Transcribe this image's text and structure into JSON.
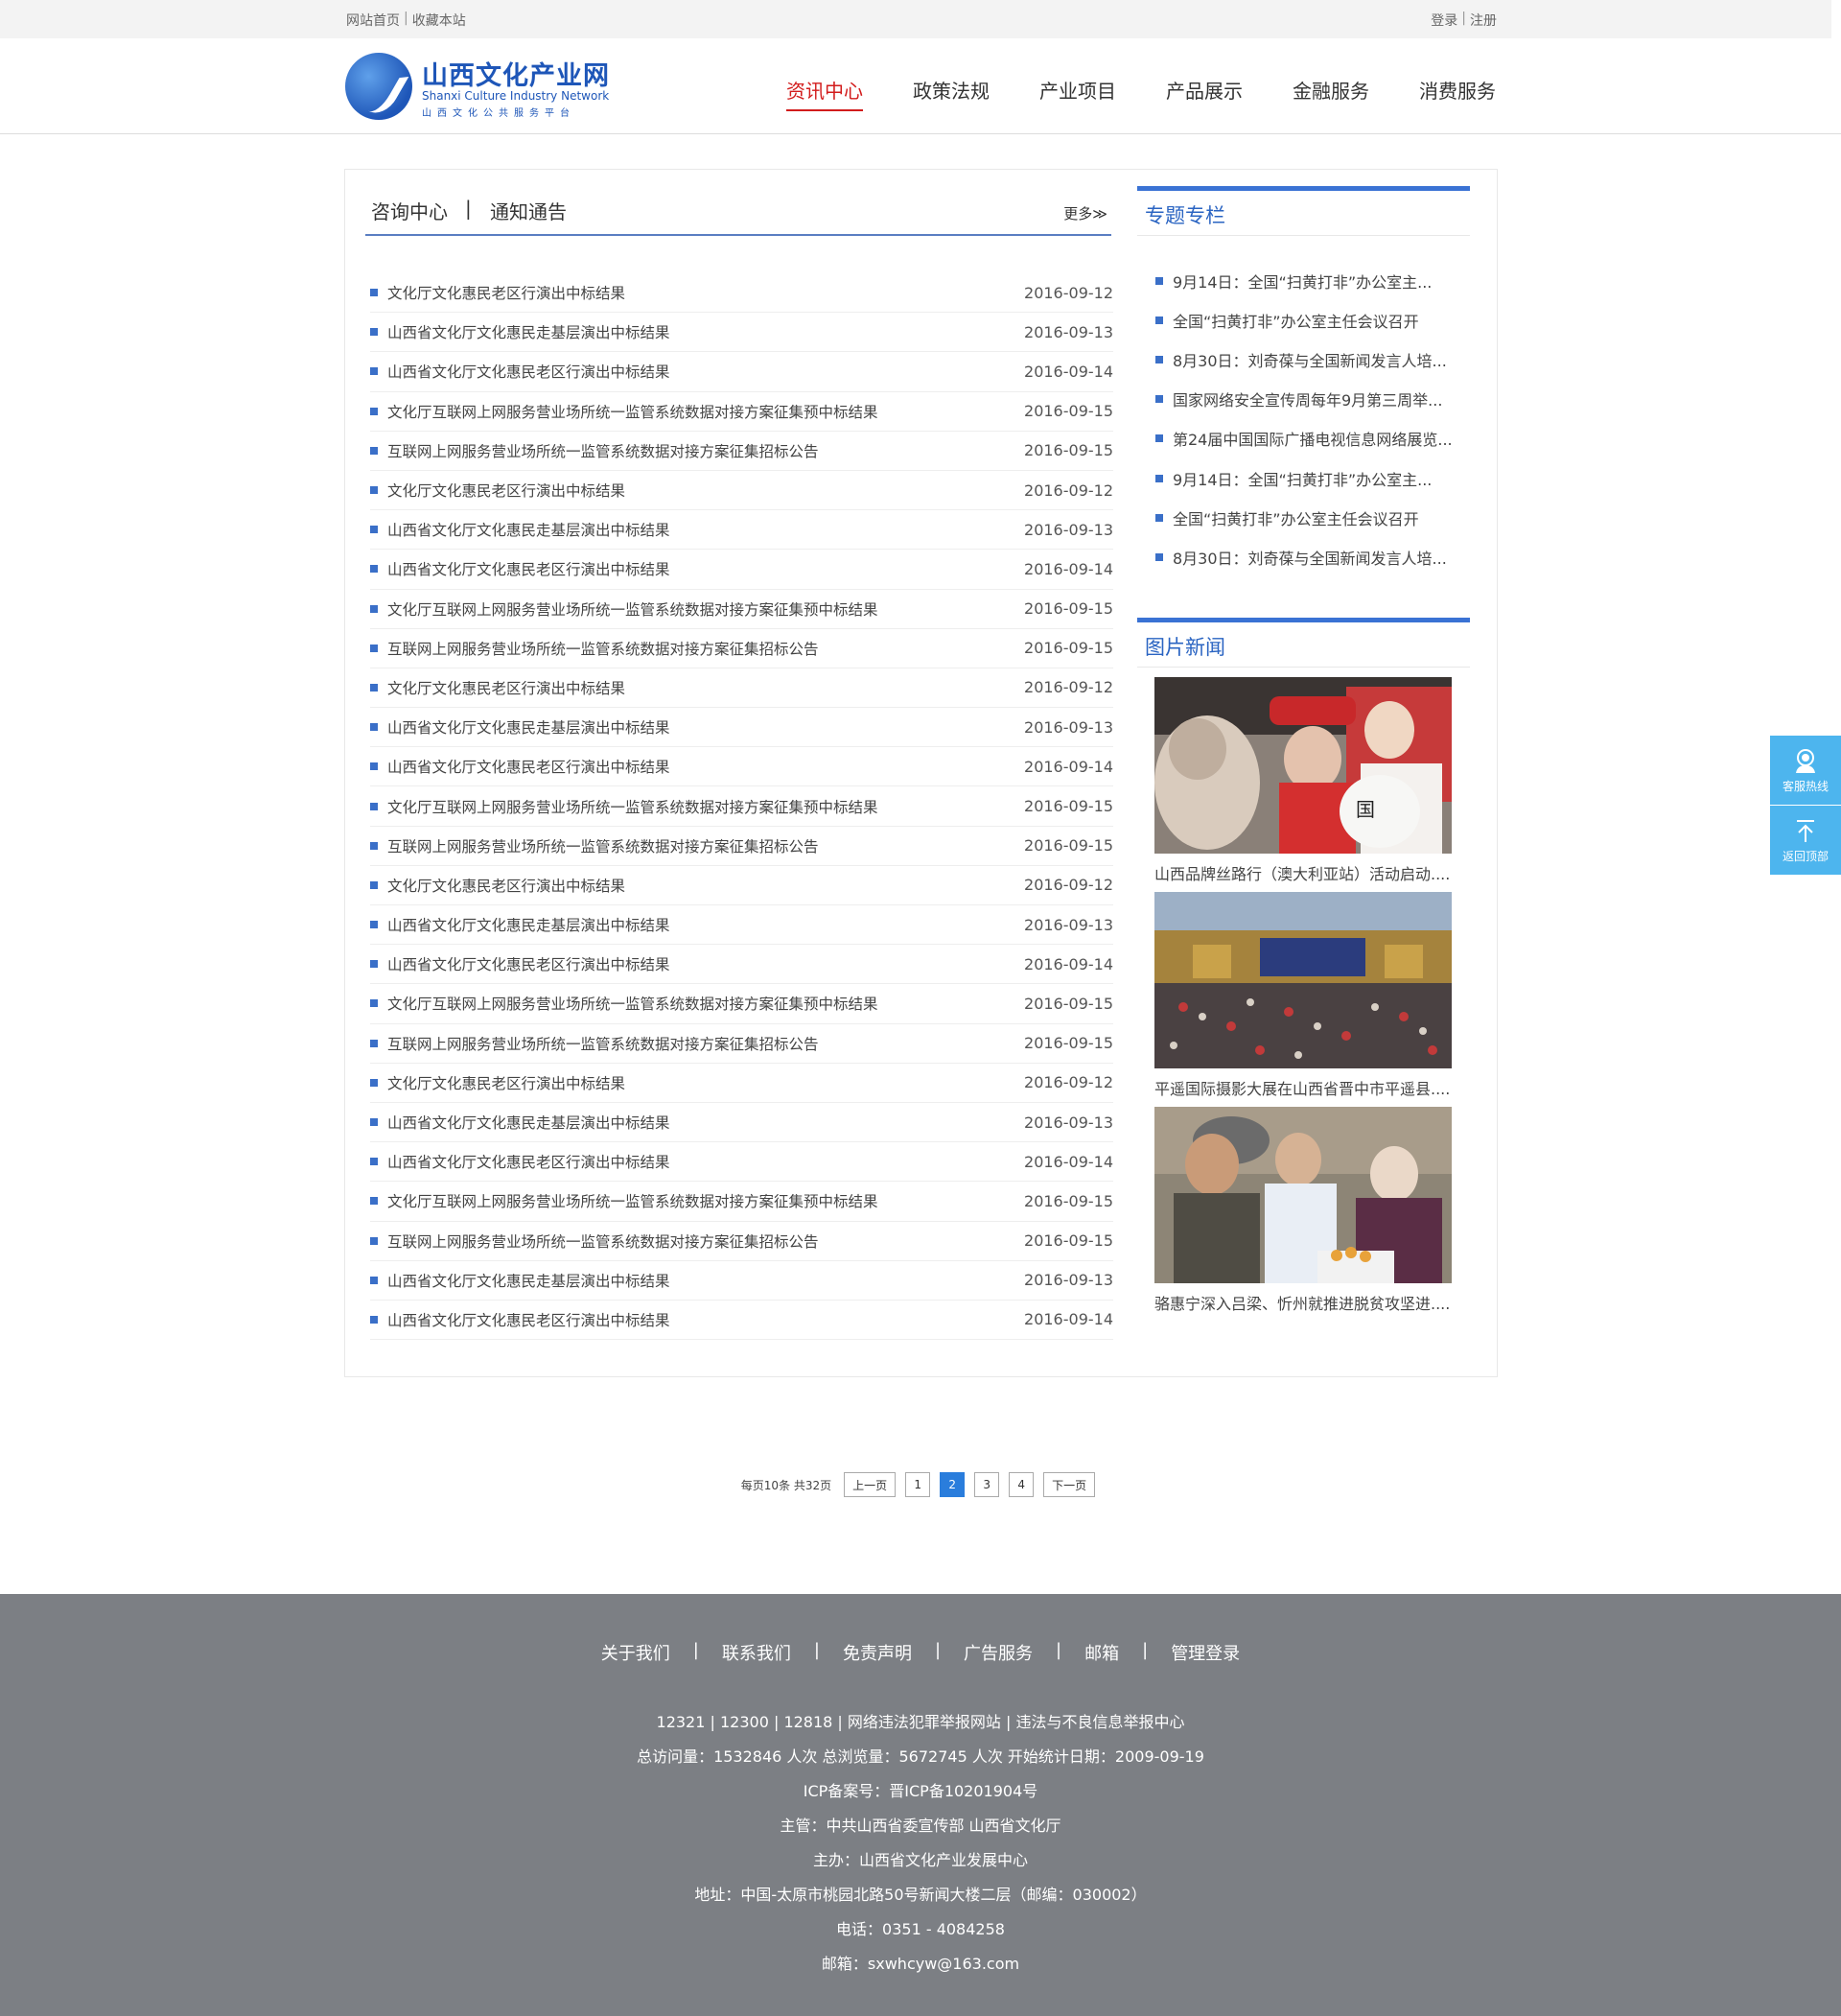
{
  "topbar": {
    "home": "网站首页",
    "favorite": "收藏本站",
    "sep": "|",
    "login": "登录",
    "register": "注册"
  },
  "logo": {
    "cn": "山西文化产业网",
    "en": "Shanxi Culture Industry Network",
    "sub": "山西文化公共服务平台"
  },
  "nav": [
    "资讯中心",
    "政策法规",
    "产业项目",
    "产品展示",
    "金融服务",
    "消费服务"
  ],
  "list": {
    "tab1": "咨询中心",
    "tabsep": "|",
    "tab2": "通知通告",
    "more": "更多≫",
    "rows": [
      {
        "title": "文化厅文化惠民老区行演出中标结果",
        "date": "2016-09-12"
      },
      {
        "title": "山西省文化厅文化惠民走基层演出中标结果",
        "date": "2016-09-13"
      },
      {
        "title": "山西省文化厅文化惠民老区行演出中标结果",
        "date": "2016-09-14"
      },
      {
        "title": "文化厅互联网上网服务营业场所统一监管系统数据对接方案征集预中标结果",
        "date": "2016-09-15"
      },
      {
        "title": "互联网上网服务营业场所统一监管系统数据对接方案征集招标公告",
        "date": "2016-09-15"
      },
      {
        "title": "文化厅文化惠民老区行演出中标结果",
        "date": "2016-09-12"
      },
      {
        "title": "山西省文化厅文化惠民走基层演出中标结果",
        "date": "2016-09-13"
      },
      {
        "title": "山西省文化厅文化惠民老区行演出中标结果",
        "date": "2016-09-14"
      },
      {
        "title": "文化厅互联网上网服务营业场所统一监管系统数据对接方案征集预中标结果",
        "date": "2016-09-15"
      },
      {
        "title": "互联网上网服务营业场所统一监管系统数据对接方案征集招标公告",
        "date": "2016-09-15"
      },
      {
        "title": "文化厅文化惠民老区行演出中标结果",
        "date": "2016-09-12"
      },
      {
        "title": "山西省文化厅文化惠民走基层演出中标结果",
        "date": "2016-09-13"
      },
      {
        "title": "山西省文化厅文化惠民老区行演出中标结果",
        "date": "2016-09-14"
      },
      {
        "title": "文化厅互联网上网服务营业场所统一监管系统数据对接方案征集预中标结果",
        "date": "2016-09-15"
      },
      {
        "title": "互联网上网服务营业场所统一监管系统数据对接方案征集招标公告",
        "date": "2016-09-15"
      },
      {
        "title": "文化厅文化惠民老区行演出中标结果",
        "date": "2016-09-12"
      },
      {
        "title": "山西省文化厅文化惠民走基层演出中标结果",
        "date": "2016-09-13"
      },
      {
        "title": "山西省文化厅文化惠民老区行演出中标结果",
        "date": "2016-09-14"
      },
      {
        "title": "文化厅互联网上网服务营业场所统一监管系统数据对接方案征集预中标结果",
        "date": "2016-09-15"
      },
      {
        "title": "互联网上网服务营业场所统一监管系统数据对接方案征集招标公告",
        "date": "2016-09-15"
      },
      {
        "title": "文化厅文化惠民老区行演出中标结果",
        "date": "2016-09-12"
      },
      {
        "title": "山西省文化厅文化惠民走基层演出中标结果",
        "date": "2016-09-13"
      },
      {
        "title": "山西省文化厅文化惠民老区行演出中标结果",
        "date": "2016-09-14"
      },
      {
        "title": "文化厅互联网上网服务营业场所统一监管系统数据对接方案征集预中标结果",
        "date": "2016-09-15"
      },
      {
        "title": "互联网上网服务营业场所统一监管系统数据对接方案征集招标公告",
        "date": "2016-09-15"
      },
      {
        "title": "山西省文化厅文化惠民走基层演出中标结果",
        "date": "2016-09-13"
      },
      {
        "title": "山西省文化厅文化惠民老区行演出中标结果",
        "date": "2016-09-14"
      }
    ]
  },
  "special": {
    "title": "专题专栏",
    "items": [
      "9月14日：全国“扫黄打非”办公室主...",
      "全国“扫黄打非”办公室主任会议召开",
      "8月30日：刘奇葆与全国新闻发言人培...",
      "国家网络安全宣传周每年9月第三周举...",
      "第24届中国国际广播电视信息网络展览...",
      "9月14日：全国“扫黄打非”办公室主...",
      "全国“扫黄打非”办公室主任会议召开",
      "8月30日：刘奇葆与全国新闻发言人培..."
    ]
  },
  "picnews": {
    "title": "图片新闻",
    "items": [
      {
        "caption": "山西品牌丝路行（澳大利亚站）活动启动...."
      },
      {
        "caption": "平遥国际摄影大展在山西省晋中市平遥县...."
      },
      {
        "caption": "骆惠宁深入吕梁、忻州就推进脱贫攻坚进...."
      }
    ]
  },
  "pager": {
    "info": "每页10条 共32页",
    "prev": "上一页",
    "pages": [
      "1",
      "2",
      "3",
      "4"
    ],
    "current": "2",
    "next": "下一页"
  },
  "footer": {
    "links": [
      "关于我们",
      "联系我们",
      "免责声明",
      "广告服务",
      "邮箱",
      "管理登录"
    ],
    "sep": "|",
    "lines": [
      "12321 | 12300 | 12818 | 网络违法犯罪举报网站 | 违法与不良信息举报中心",
      "总访问量：1532846 人次  总浏览量：5672745 人次  开始统计日期：2009-09-19",
      "ICP备案号：晋ICP备10201904号",
      "主管：中共山西省委宣传部 山西省文化厅",
      "主办：山西省文化产业发展中心",
      "地址：中国-太原市桃园北路50号新闻大楼二层（邮编：030002）",
      "电话：0351 - 4084258",
      "邮箱：sxwhcyw@163.com"
    ]
  },
  "float": {
    "hotline": "客服热线",
    "top": "返回顶部"
  },
  "colors": {
    "brand_blue": "#1e56b8",
    "nav_active": "#d21c1c",
    "pager_current": "#2a7ddc",
    "footer_bg": "#7c7f84",
    "float_bg": "#4db5ee"
  }
}
